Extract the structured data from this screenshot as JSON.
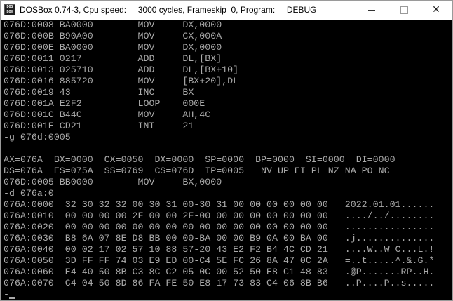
{
  "window": {
    "title": "DOSBox 0.74-3, Cpu speed:     3000 cycles, Frameskip  0, Program:     DEBUG",
    "icon_text": [
      "DOS",
      "BOX"
    ],
    "minimize_icon": "minimize-icon",
    "maximize_icon": "maximize-icon",
    "close_icon": "close-icon",
    "close_glyph": "✕"
  },
  "terminal": {
    "lines": [
      "076D:0008 BA0000        MOV     DX,0000",
      "076D:000B B90A00        MOV     CX,000A",
      "076D:000E BA0000        MOV     DX,0000",
      "076D:0011 0217          ADD     DL,[BX]",
      "076D:0013 025710        ADD     DL,[BX+10]",
      "076D:0016 885720        MOV     [BX+20],DL",
      "076D:0019 43            INC     BX",
      "076D:001A E2F2          LOOP    000E",
      "076D:001C B44C          MOV     AH,4C",
      "076D:001E CD21          INT     21",
      "-g 076d:0005",
      "",
      "AX=076A  BX=0000  CX=0050  DX=0000  SP=0000  BP=0000  SI=0000  DI=0000",
      "DS=076A  ES=075A  SS=0769  CS=076D  IP=0005   NV UP EI PL NZ NA PO NC",
      "076D:0005 BB0000        MOV     BX,0000",
      "-d 076a:0",
      "076A:0000  32 30 32 32 00 30 31 00-30 31 00 00 00 00 00 00   2022.01.01......",
      "076A:0010  00 00 00 00 2F 00 00 2F-00 00 00 00 00 00 00 00   ..../../........",
      "076A:0020  00 00 00 00 00 00 00 00-00 00 00 00 00 00 00 00   ................",
      "076A:0030  B8 6A 07 8E D8 BB 00 00-BA 00 00 B9 0A 00 BA 00   .j..............",
      "076A:0040  00 02 17 02 57 10 88 57-20 43 E2 F2 B4 4C CD 21   ....W..W C...L.!",
      "076A:0050  3D FF FF 74 03 E9 ED 00-C4 5E FC 26 8A 47 0C 2A   =..t.....^.&.G.*",
      "076A:0060  E4 40 50 8B C3 8C C2 05-0C 00 52 50 E8 C1 48 83   .@P.......RP..H.",
      "076A:0070  C4 04 50 8D 86 FA FE 50-E8 17 73 83 C4 06 8B B6   ..P....P..s....."
    ],
    "prompt": "-"
  },
  "colors": {
    "terminal_bg": "#000000",
    "terminal_fg": "#aaaaaa",
    "titlebar_bg": "#ffffff"
  }
}
